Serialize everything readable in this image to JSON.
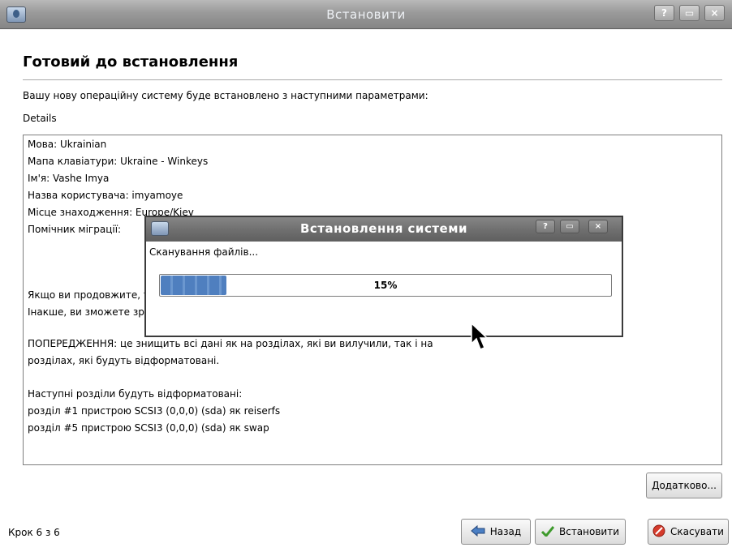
{
  "window": {
    "title": "Встановити",
    "buttons": [
      "?",
      "▭",
      "×"
    ]
  },
  "page": {
    "heading": "Готовий до встановлення",
    "intro": "Вашу нову операційну систему буде встановлено з наступними параметрами:",
    "details_label": "Details"
  },
  "details": {
    "lines": [
      "Мова: Ukrainian",
      "Мапа клавіатури: Ukraine - Winkeys",
      "Ім'я: Vashe Imya",
      "Назва користувача: imyamoye",
      "Місце знаходження: Europe/Kiev",
      "Помічник міграції:",
      "Якщо ви продовжите, т",
      "Інакше, ви зможете зро",
      "ПОПЕРЕДЖЕННЯ: це знищить всі дані як на розділах, які ви вилучили, так і на",
      "розділах, які будуть відформатовані.",
      "Наступні розділи будуть відформатовані:",
      "розділ #1 пристрою SCSI3 (0,0,0) (sda) як reiserfs",
      "розділ #5 пристрою SCSI3 (0,0,0) (sda) як swap"
    ]
  },
  "buttons": {
    "advanced": "Додатково...",
    "back": "Назад",
    "install": "Встановити",
    "cancel": "Скасувати"
  },
  "footer": {
    "step": "Крок 6 з 6"
  },
  "dialog": {
    "title": "Встановлення системи",
    "status": "Сканування файлів...",
    "progress": 15,
    "progress_label": "15%",
    "buttons": [
      "?",
      "▭",
      "×"
    ]
  },
  "colors": {
    "progress_fill": "#4f7fbf",
    "titlebar": "#9a9a9a",
    "dialog_titlebar": "#707070"
  }
}
